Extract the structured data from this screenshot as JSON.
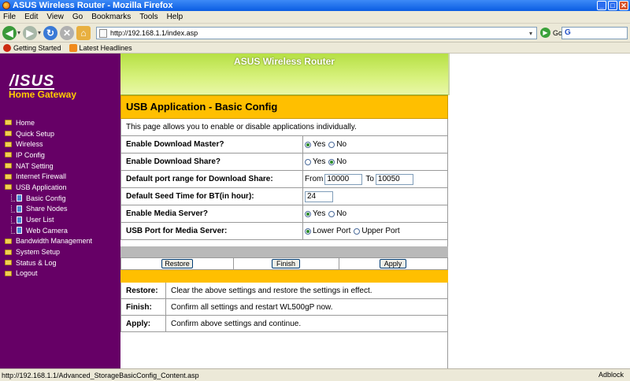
{
  "window": {
    "title": "ASUS Wireless Router - Mozilla Firefox",
    "minimize": "_",
    "maximize": "□",
    "close": "✕"
  },
  "menubar": [
    "File",
    "Edit",
    "View",
    "Go",
    "Bookmarks",
    "Tools",
    "Help"
  ],
  "nav": {
    "url": "http://192.168.1.1/index.asp",
    "go_label": "Go",
    "search_glyph": "G"
  },
  "bookmarks": [
    "Getting Started",
    "Latest Headlines"
  ],
  "router": {
    "logo": "/ISUS",
    "subtitle": "Home Gateway",
    "header_title": "ASUS Wireless Router",
    "menu": [
      {
        "label": "Home",
        "type": "folder"
      },
      {
        "label": "Quick Setup",
        "type": "folder"
      },
      {
        "label": "Wireless",
        "type": "folder"
      },
      {
        "label": "IP Config",
        "type": "folder"
      },
      {
        "label": "NAT Setting",
        "type": "folder"
      },
      {
        "label": "Internet Firewall",
        "type": "folder"
      },
      {
        "label": "USB Application",
        "type": "folder-open"
      },
      {
        "label": "Basic Config",
        "type": "page"
      },
      {
        "label": "Share Nodes",
        "type": "page"
      },
      {
        "label": "User List",
        "type": "page"
      },
      {
        "label": "Web Camera",
        "type": "page"
      },
      {
        "label": "Bandwidth Management",
        "type": "folder"
      },
      {
        "label": "System Setup",
        "type": "folder"
      },
      {
        "label": "Status & Log",
        "type": "folder"
      },
      {
        "label": "Logout",
        "type": "folder"
      }
    ]
  },
  "config": {
    "title": "USB Application - Basic Config",
    "description": "This page allows you to enable or disable applications individually.",
    "rows": {
      "download_master": {
        "label": "Enable Download Master?",
        "opt1": "Yes",
        "opt2": "No"
      },
      "download_share": {
        "label": "Enable Download Share?",
        "opt1": "Yes",
        "opt2": "No"
      },
      "port_range": {
        "label": "Default port range for Download Share:",
        "from_label": "From",
        "from_value": "10000",
        "to_label": "To",
        "to_value": "10050"
      },
      "seed_time": {
        "label": "Default Seed Time for BT(in hour):",
        "value": "24"
      },
      "media_server": {
        "label": "Enable Media Server?",
        "opt1": "Yes",
        "opt2": "No"
      },
      "usb_port": {
        "label": "USB Port for Media Server:",
        "opt1": "Lower Port",
        "opt2": "Upper Port"
      }
    },
    "buttons": {
      "restore": "Restore",
      "finish": "Finish",
      "apply": "Apply"
    },
    "help": [
      {
        "label": "Restore:",
        "text": "Clear the above settings and restore the settings in effect."
      },
      {
        "label": "Finish:",
        "text": "Confirm all settings and restart WL500gP now."
      },
      {
        "label": "Apply:",
        "text": "Confirm above settings and continue."
      }
    ]
  },
  "status": {
    "text": "http://192.168.1.1/Advanced_StorageBasicConfig_Content.asp",
    "adblock": "Adblock"
  }
}
